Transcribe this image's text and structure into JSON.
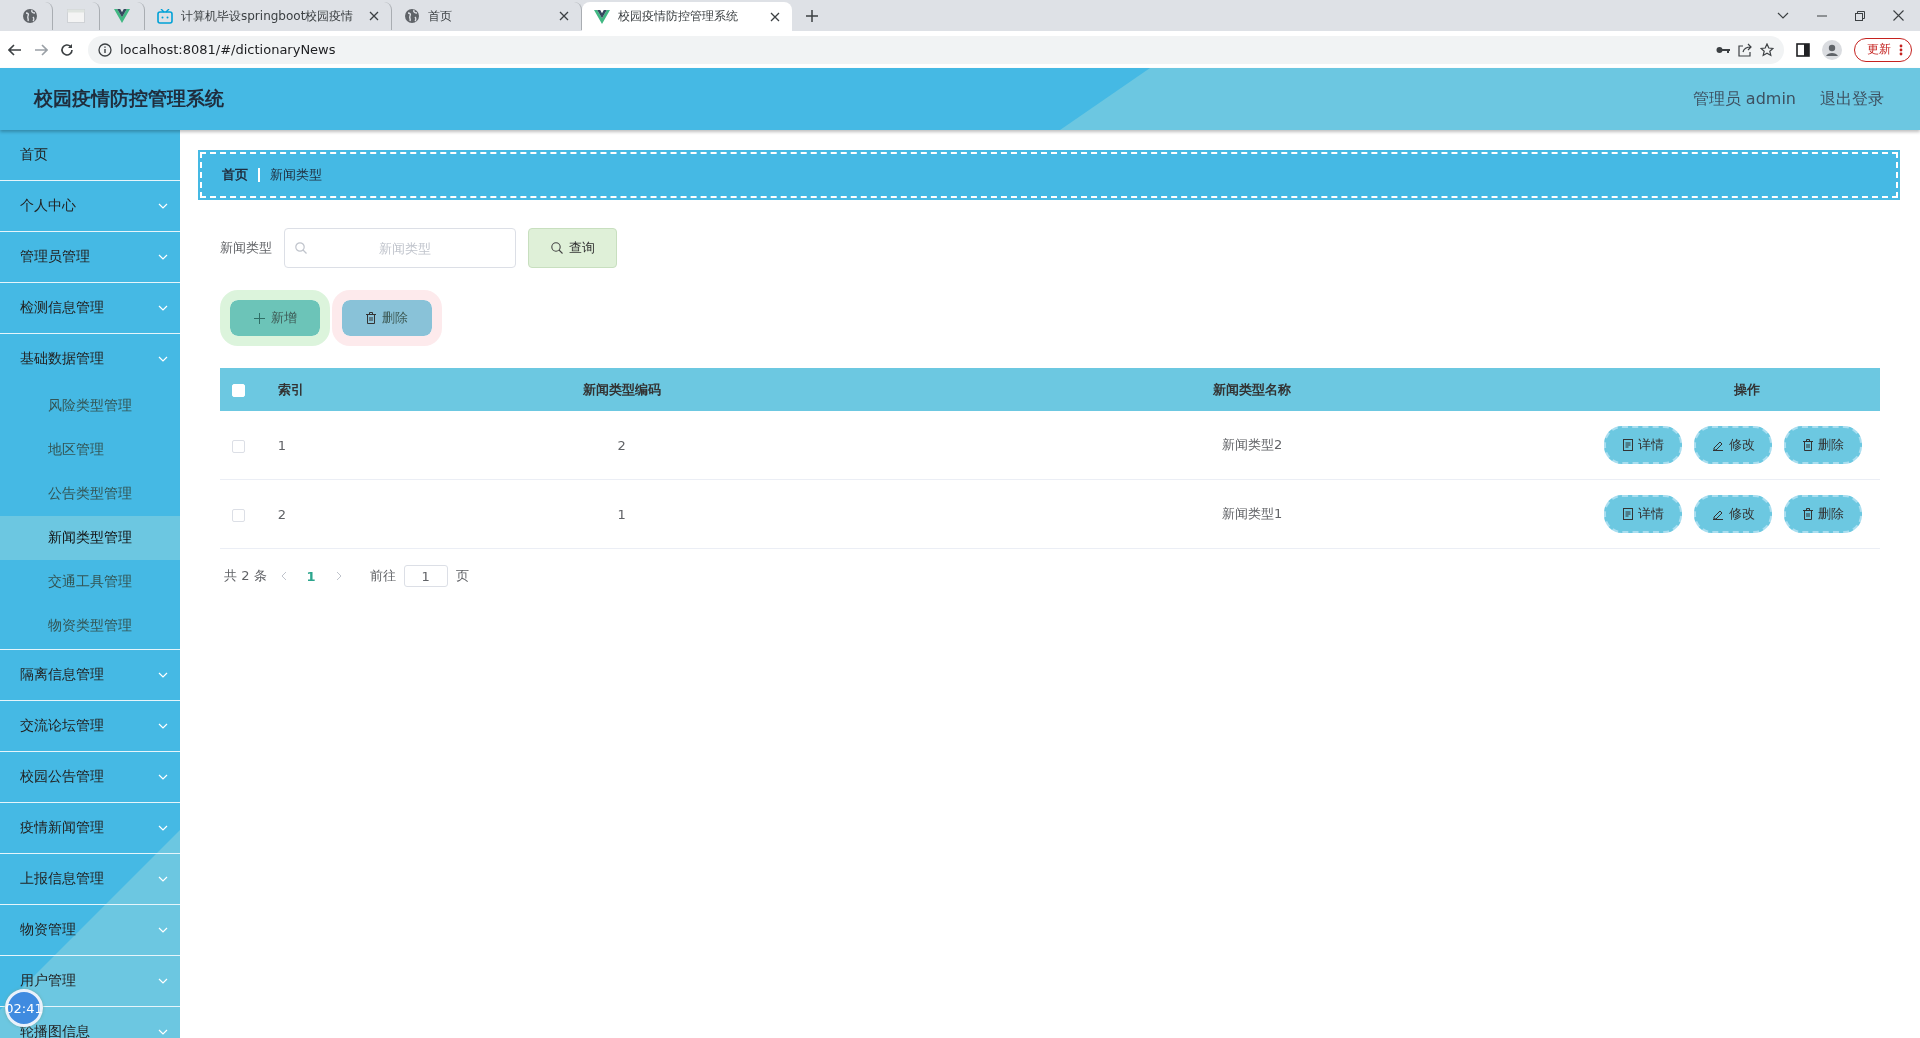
{
  "browser": {
    "tabs": [
      {
        "kind": "globe",
        "selected": false
      },
      {
        "kind": "blank",
        "selected": false
      },
      {
        "kind": "vue",
        "selected": false
      },
      {
        "kind": "tv",
        "label": "计算机毕设springboot校园疫情",
        "selected": false
      },
      {
        "kind": "globe",
        "label": "首页",
        "selected": false
      },
      {
        "kind": "vue",
        "label": "校园疫情防控管理系统",
        "selected": true
      }
    ],
    "url": "localhost:8081/#/dictionaryNews",
    "update_button": "更新"
  },
  "header": {
    "title": "校园疫情防控管理系统",
    "user": "管理员 admin",
    "logout": "退出登录"
  },
  "sidebar": {
    "items": [
      {
        "kind": "link",
        "label": "首页"
      },
      {
        "kind": "menu",
        "label": "个人中心"
      },
      {
        "kind": "menu",
        "label": "管理员管理"
      },
      {
        "kind": "menu",
        "label": "检测信息管理"
      },
      {
        "kind": "menu",
        "label": "基础数据管理",
        "expanded": true,
        "children": [
          {
            "label": "风险类型管理",
            "selected": false
          },
          {
            "label": "地区管理",
            "selected": false
          },
          {
            "label": "公告类型管理",
            "selected": false
          },
          {
            "label": "新闻类型管理",
            "selected": true
          },
          {
            "label": "交通工具管理",
            "selected": false
          },
          {
            "label": "物资类型管理",
            "selected": false
          }
        ]
      },
      {
        "kind": "menu",
        "label": "隔离信息管理"
      },
      {
        "kind": "menu",
        "label": "交流论坛管理"
      },
      {
        "kind": "menu",
        "label": "校园公告管理"
      },
      {
        "kind": "menu",
        "label": "疫情新闻管理"
      },
      {
        "kind": "menu",
        "label": "上报信息管理"
      },
      {
        "kind": "menu",
        "label": "物资管理"
      },
      {
        "kind": "menu",
        "label": "用户管理"
      },
      {
        "kind": "menu",
        "label": "轮播图信息"
      }
    ]
  },
  "timer_badge": "02:41",
  "breadcrumb": [
    "首页",
    "新闻类型"
  ],
  "search": {
    "label": "新闻类型",
    "placeholder": "新闻类型",
    "button": "查询"
  },
  "actions": [
    {
      "kind": "add",
      "label": "新增"
    },
    {
      "kind": "delete",
      "label": "删除"
    }
  ],
  "table": {
    "header_checked": false,
    "columns": [
      "索引",
      "新闻类型编码",
      "新闻类型名称",
      "操作"
    ],
    "rows": [
      {
        "checked": false,
        "cells": [
          "1",
          "2",
          "新闻类型2"
        ],
        "buttons": [
          {
            "kind": "detail",
            "label": "详情"
          },
          {
            "kind": "edit",
            "label": "修改"
          },
          {
            "kind": "delete",
            "label": "删除"
          }
        ]
      },
      {
        "checked": false,
        "cells": [
          "2",
          "1",
          "新闻类型1"
        ],
        "buttons": [
          {
            "kind": "detail",
            "label": "详情"
          },
          {
            "kind": "edit",
            "label": "修改"
          },
          {
            "kind": "delete",
            "label": "删除"
          }
        ]
      }
    ]
  },
  "pagination": {
    "total": "共 2 条",
    "pages": [
      {
        "label": "1",
        "selected": true
      }
    ],
    "goto": "前往",
    "page_value": "1",
    "page_unit": "页"
  }
}
